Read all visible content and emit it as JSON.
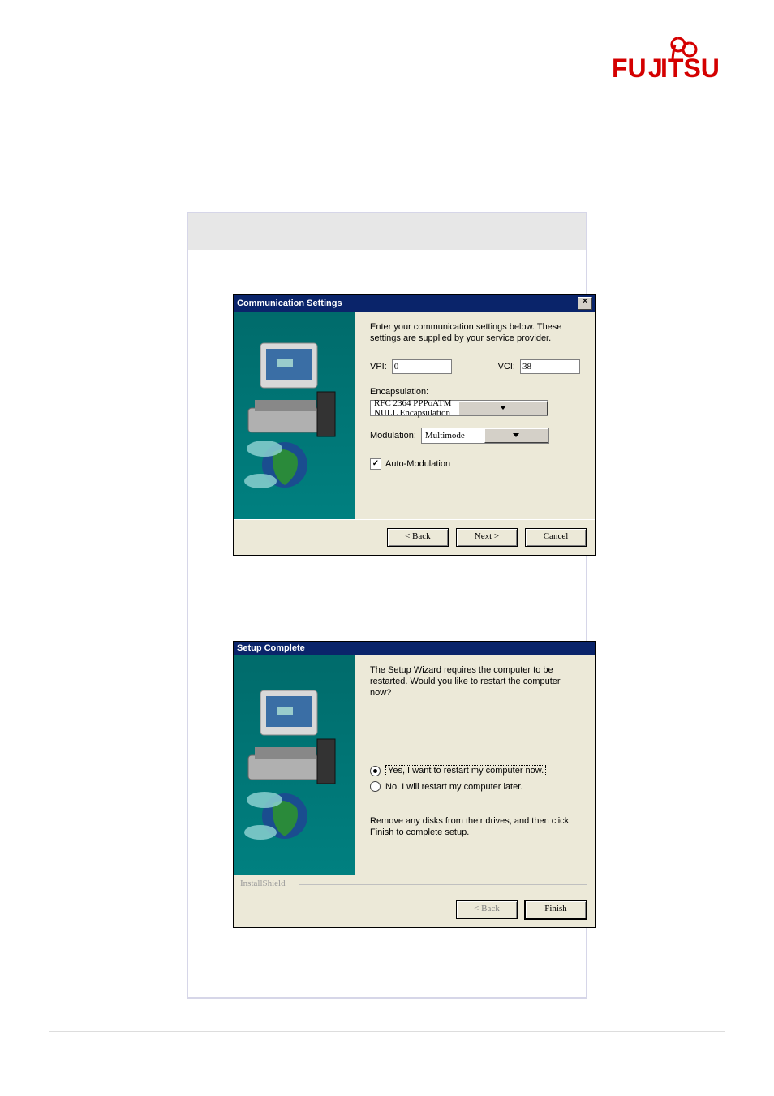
{
  "brand": "FUJITSU",
  "dialog1": {
    "title": "Communication Settings",
    "instruction": "Enter your communication settings below.  These settings are supplied by your service provider.",
    "vpi_label": "VPI:",
    "vpi_value": "0",
    "vci_label": "VCI:",
    "vci_value": "38",
    "encap_label": "Encapsulation:",
    "encap_value": "RFC 2364 PPPoATM NULL Encapsulation",
    "mod_label": "Modulation:",
    "mod_value": "Multimode",
    "auto_mod_label": "Auto-Modulation",
    "auto_mod_checked": true,
    "btn_back": "< Back",
    "btn_next": "Next >",
    "btn_cancel": "Cancel"
  },
  "dialog2": {
    "title": "Setup Complete",
    "instruction": "The Setup Wizard requires the computer to be restarted.  Would you like to restart the computer now?",
    "radio_yes": "Yes, I want to restart my computer now.",
    "radio_no": "No, I will restart my computer later.",
    "remove_text": "Remove any disks from their drives, and then click Finish to complete setup.",
    "installshield": "InstallShield",
    "btn_back": "< Back",
    "btn_finish": "Finish"
  }
}
